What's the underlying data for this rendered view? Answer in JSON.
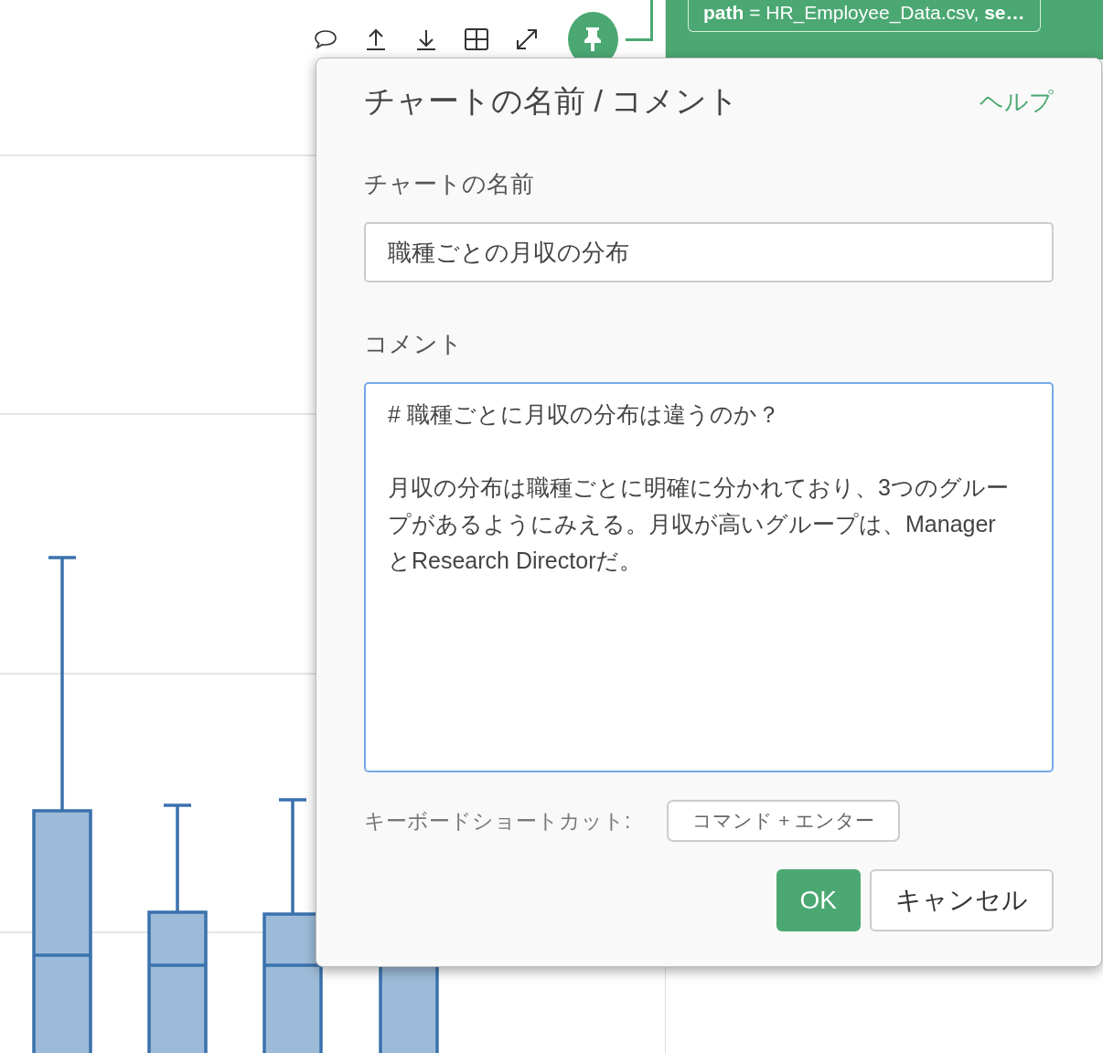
{
  "node_label": "**path** = HR_Employee_Data.csv, **se…**",
  "dialog": {
    "title": "チャートの名前 / コメント",
    "help_link": "ヘルプ",
    "name_label": "チャートの名前",
    "name_value": "職種ごとの月収の分布",
    "comment_label": "コメント",
    "comment_heading": "# 職種ごとに月収の分布は違うのか？",
    "comment_paragraph": "月収の分布は職種ごとに明確に分かれており、3つのグループがあるようにみえる。月収が高いグループは、ManagerとResearch Directorだ。",
    "shortcut_label": "キーボードショートカット:",
    "shortcut_keys": "コマンド + エンター",
    "buttons": [
      {
        "kind": "primary",
        "label": "OK"
      },
      {
        "kind": "secondary",
        "label": "キャンセル"
      }
    ]
  }
}
